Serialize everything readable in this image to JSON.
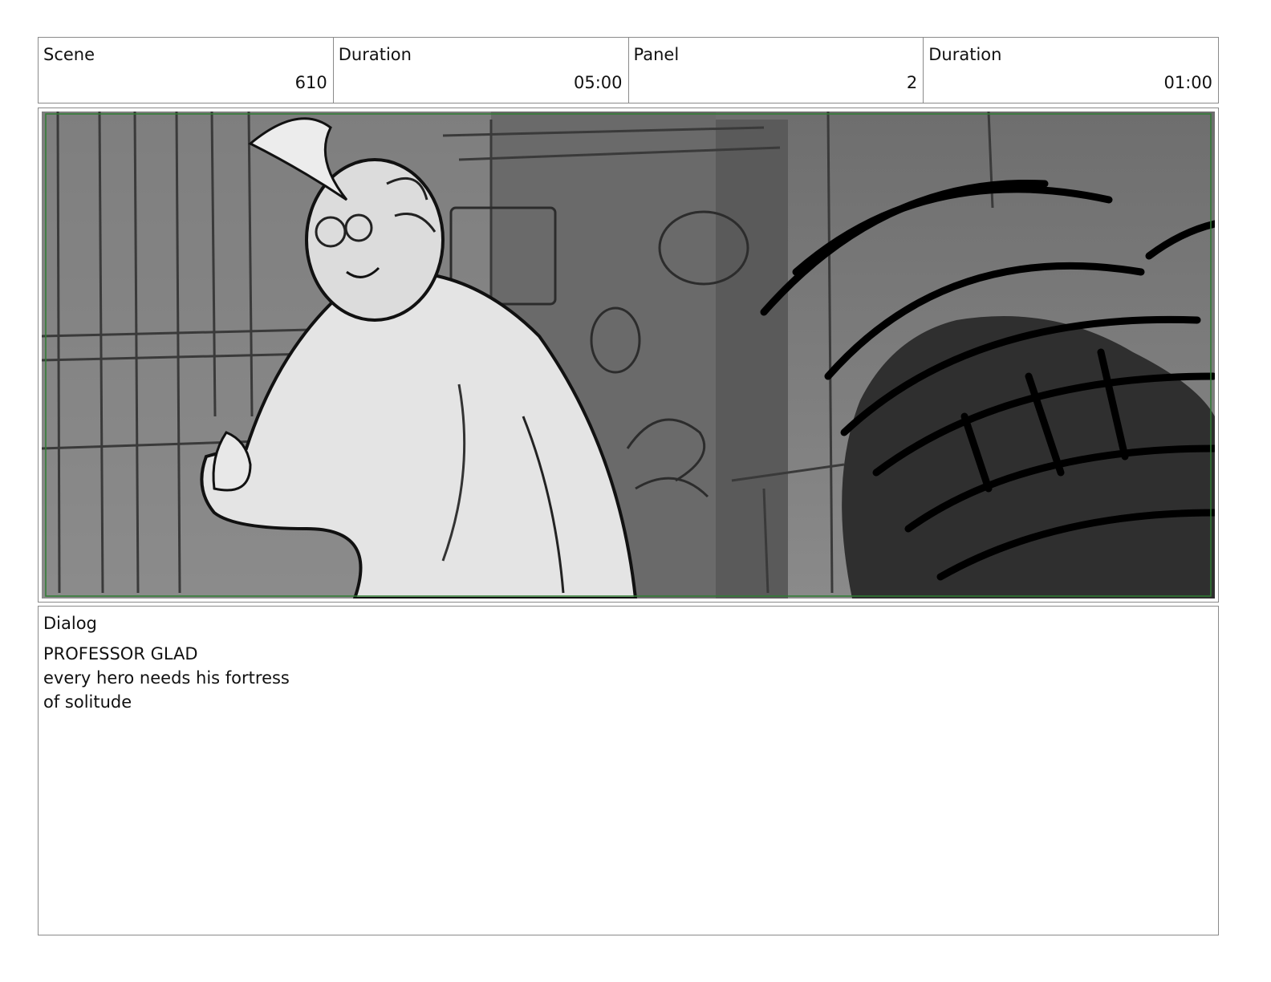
{
  "header": {
    "cells": [
      {
        "label": "Scene",
        "value": "610"
      },
      {
        "label": "Duration",
        "value": "05:00"
      },
      {
        "label": "Panel",
        "value": "2"
      },
      {
        "label": "Duration",
        "value": "01:00"
      }
    ]
  },
  "dialog": {
    "label": "Dialog",
    "character": "PROFESSOR GLAD",
    "lines": [
      "every hero needs his fortress",
      "of solitude"
    ]
  },
  "colors": {
    "border": "#8a8a8a",
    "safe_frame": "#2e7d32",
    "background_mid_gray": "#7a7a7a",
    "foreground_dark": "#2a2a2a"
  }
}
